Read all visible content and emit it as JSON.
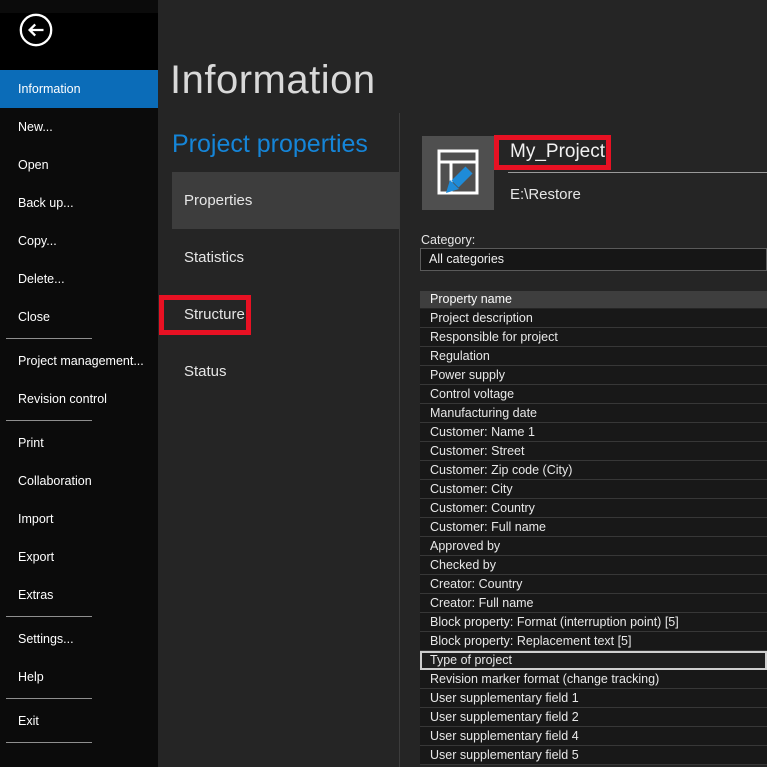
{
  "colors": {
    "accent-blue": "#0b6cb8",
    "heading-blue": "#1585d8",
    "annotation-red": "#e81123",
    "pencil-blue": "#1e8bd8",
    "icon-tile-gray": "#4f4f4f"
  },
  "sidebar": {
    "back_icon": "back-arrow-in-circle",
    "items": [
      {
        "label": "Information",
        "selected": true
      },
      {
        "label": "New..."
      },
      {
        "label": "Open"
      },
      {
        "label": "Back up..."
      },
      {
        "label": "Copy..."
      },
      {
        "label": "Delete..."
      },
      {
        "label": "Close",
        "divider_after": true
      },
      {
        "label": "Project management..."
      },
      {
        "label": "Revision control",
        "divider_after": true
      },
      {
        "label": "Print"
      },
      {
        "label": "Collaboration"
      },
      {
        "label": "Import"
      },
      {
        "label": "Export"
      },
      {
        "label": "Extras",
        "divider_after": true
      },
      {
        "label": "Settings..."
      },
      {
        "label": "Help",
        "divider_after": true
      },
      {
        "label": "Exit",
        "divider_after": true
      }
    ]
  },
  "main": {
    "title": "Information",
    "section_title": "Project properties",
    "tabs": [
      {
        "label": "Properties",
        "selected": true
      },
      {
        "label": "Statistics"
      },
      {
        "label": "Structure",
        "annotated": true
      },
      {
        "label": "Status"
      }
    ]
  },
  "details": {
    "project_icon": "project-frame-with-edit-pencil",
    "project_name": "My_Project",
    "project_path": "E:\\Restore",
    "category_label": "Category:",
    "category_value": "All categories",
    "table": {
      "header": "Property name",
      "rows": [
        {
          "name": "Project description"
        },
        {
          "name": "Responsible for project"
        },
        {
          "name": "Regulation"
        },
        {
          "name": "Power supply"
        },
        {
          "name": "Control voltage"
        },
        {
          "name": "Manufacturing date"
        },
        {
          "name": "Customer: Name 1"
        },
        {
          "name": "Customer: Street"
        },
        {
          "name": "Customer: Zip code (City)"
        },
        {
          "name": "Customer: City"
        },
        {
          "name": "Customer: Country"
        },
        {
          "name": "Customer: Full name"
        },
        {
          "name": "Approved by"
        },
        {
          "name": "Checked by"
        },
        {
          "name": "Creator: Country"
        },
        {
          "name": "Creator: Full name"
        },
        {
          "name": "Block property: Format (interruption point) [5]"
        },
        {
          "name": "Block property: Replacement text [5]"
        },
        {
          "name": "Type of project",
          "selected": true
        },
        {
          "name": "Revision marker format (change tracking)"
        },
        {
          "name": "User supplementary field 1"
        },
        {
          "name": "User supplementary field 2"
        },
        {
          "name": "User supplementary field 4"
        },
        {
          "name": "User supplementary field 5"
        }
      ]
    }
  }
}
